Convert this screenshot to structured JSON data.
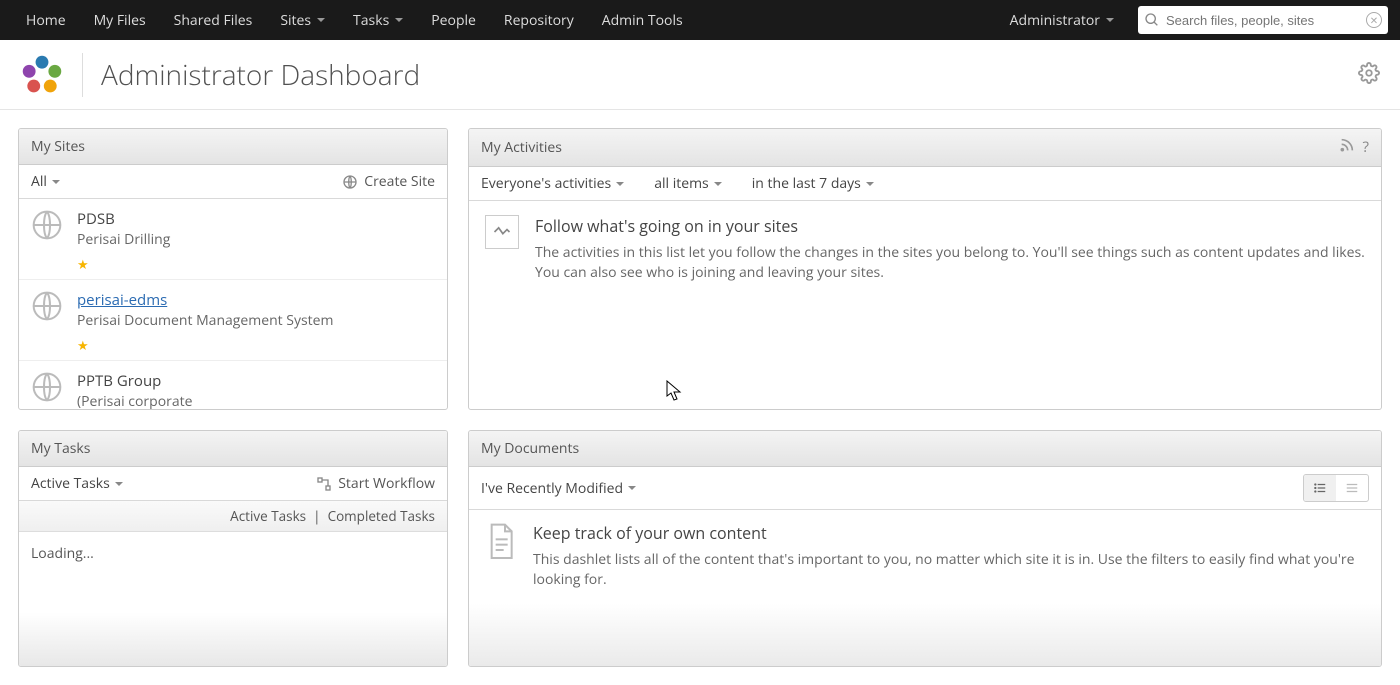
{
  "nav": {
    "items": [
      "Home",
      "My Files",
      "Shared Files",
      "Sites",
      "Tasks",
      "People",
      "Repository",
      "Admin Tools"
    ],
    "dropdown_indices": [
      3,
      4
    ],
    "user": "Administrator",
    "search_placeholder": "Search files, people, sites"
  },
  "header": {
    "title": "Administrator Dashboard"
  },
  "my_sites": {
    "title": "My Sites",
    "filter": "All",
    "create": "Create Site",
    "sites": [
      {
        "name": "PDSB",
        "desc": "Perisai Drilling",
        "favorite": true,
        "link": false
      },
      {
        "name": "perisai-edms",
        "desc": "Perisai Document Management System",
        "favorite": true,
        "link": true
      },
      {
        "name": "PPTB Group",
        "desc": "(Perisai corporate",
        "favorite": true,
        "link": false
      }
    ]
  },
  "my_activities": {
    "title": "My Activities",
    "filters": [
      "Everyone's activities",
      "all items",
      "in the last 7 days"
    ],
    "heading": "Follow what's going on in your sites",
    "body": "The activities in this list let you follow the changes in the sites you belong to. You'll see things such as content updates and likes. You can also see who is joining and leaving your sites."
  },
  "my_tasks": {
    "title": "My Tasks",
    "filter": "Active Tasks",
    "start": "Start Workflow",
    "links": {
      "active": "Active Tasks",
      "completed": "Completed Tasks"
    },
    "loading": "Loading..."
  },
  "my_documents": {
    "title": "My Documents",
    "filter": "I've Recently Modified",
    "heading": "Keep track of your own content",
    "body": "This dashlet lists all of the content that's important to you, no matter which site it is in. Use the filters to easily find what you're looking for."
  }
}
